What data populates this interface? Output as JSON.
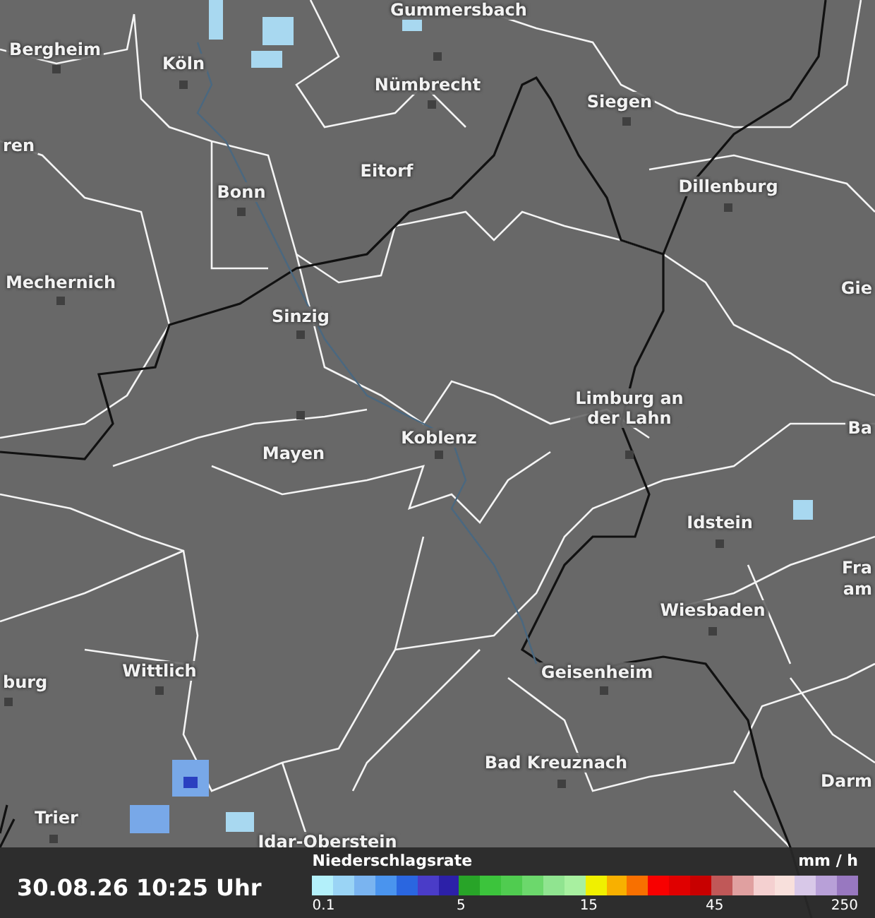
{
  "map": {
    "places": [
      {
        "name": "Gummersbach",
        "kind": "city"
      },
      {
        "name": "Bergheim",
        "kind": "city"
      },
      {
        "name": "Köln",
        "kind": "city"
      },
      {
        "name": "Nümbrecht",
        "kind": "city"
      },
      {
        "name": "Siegen",
        "kind": "city"
      },
      {
        "name": "ren",
        "kind": "edge"
      },
      {
        "name": "Eitorf",
        "kind": "city"
      },
      {
        "name": "Bonn",
        "kind": "city"
      },
      {
        "name": "Dillenburg",
        "kind": "city"
      },
      {
        "name": "Mechernich",
        "kind": "city"
      },
      {
        "name": "Gie",
        "kind": "edge"
      },
      {
        "name": "Sinzig",
        "kind": "city"
      },
      {
        "name": "Limburg an der Lahn",
        "kind": "city"
      },
      {
        "name": "Ba",
        "kind": "edge"
      },
      {
        "name": "Koblenz",
        "kind": "city"
      },
      {
        "name": "Mayen",
        "kind": "city"
      },
      {
        "name": "Idstein",
        "kind": "city"
      },
      {
        "name": "Fra",
        "kind": "edge"
      },
      {
        "name": "am",
        "kind": "edge"
      },
      {
        "name": "Wiesbaden",
        "kind": "city"
      },
      {
        "name": "Wittlich",
        "kind": "city"
      },
      {
        "name": "Geisenheim",
        "kind": "city"
      },
      {
        "name": "burg",
        "kind": "edge"
      },
      {
        "name": "Bad Kreuznach",
        "kind": "city"
      },
      {
        "name": "Darm",
        "kind": "edge"
      },
      {
        "name": "Trier",
        "kind": "city"
      },
      {
        "name": "Idar-Oberstein",
        "kind": "city"
      }
    ]
  },
  "footer": {
    "timestamp": "30.08.26 10:25 Uhr",
    "legend": {
      "title": "Niederschlagsrate",
      "unit": "mm / h",
      "swatches": [
        {
          "color": "#b3f0fa"
        },
        {
          "color": "#9ad4f5"
        },
        {
          "color": "#7ab4f0"
        },
        {
          "color": "#4a94ee"
        },
        {
          "color": "#2a66e0"
        },
        {
          "color": "#4a3cc8"
        },
        {
          "color": "#2c20a8"
        },
        {
          "color": "#28a428"
        },
        {
          "color": "#3cc43c"
        },
        {
          "color": "#50cc50"
        },
        {
          "color": "#6cd86c"
        },
        {
          "color": "#90e490"
        },
        {
          "color": "#a8f0a0"
        },
        {
          "color": "#f0f000"
        },
        {
          "color": "#f8b000"
        },
        {
          "color": "#f87000"
        },
        {
          "color": "#f80000"
        },
        {
          "color": "#e00000"
        },
        {
          "color": "#c80000"
        },
        {
          "color": "#c05858"
        },
        {
          "color": "#e0a0a0"
        },
        {
          "color": "#f4d0d0"
        },
        {
          "color": "#f8e0dc"
        },
        {
          "color": "#d8c8e8"
        },
        {
          "color": "#b8a0d8"
        },
        {
          "color": "#9878c0"
        }
      ],
      "ticks": [
        "0.1",
        "5",
        "15",
        "45",
        "250"
      ]
    }
  }
}
